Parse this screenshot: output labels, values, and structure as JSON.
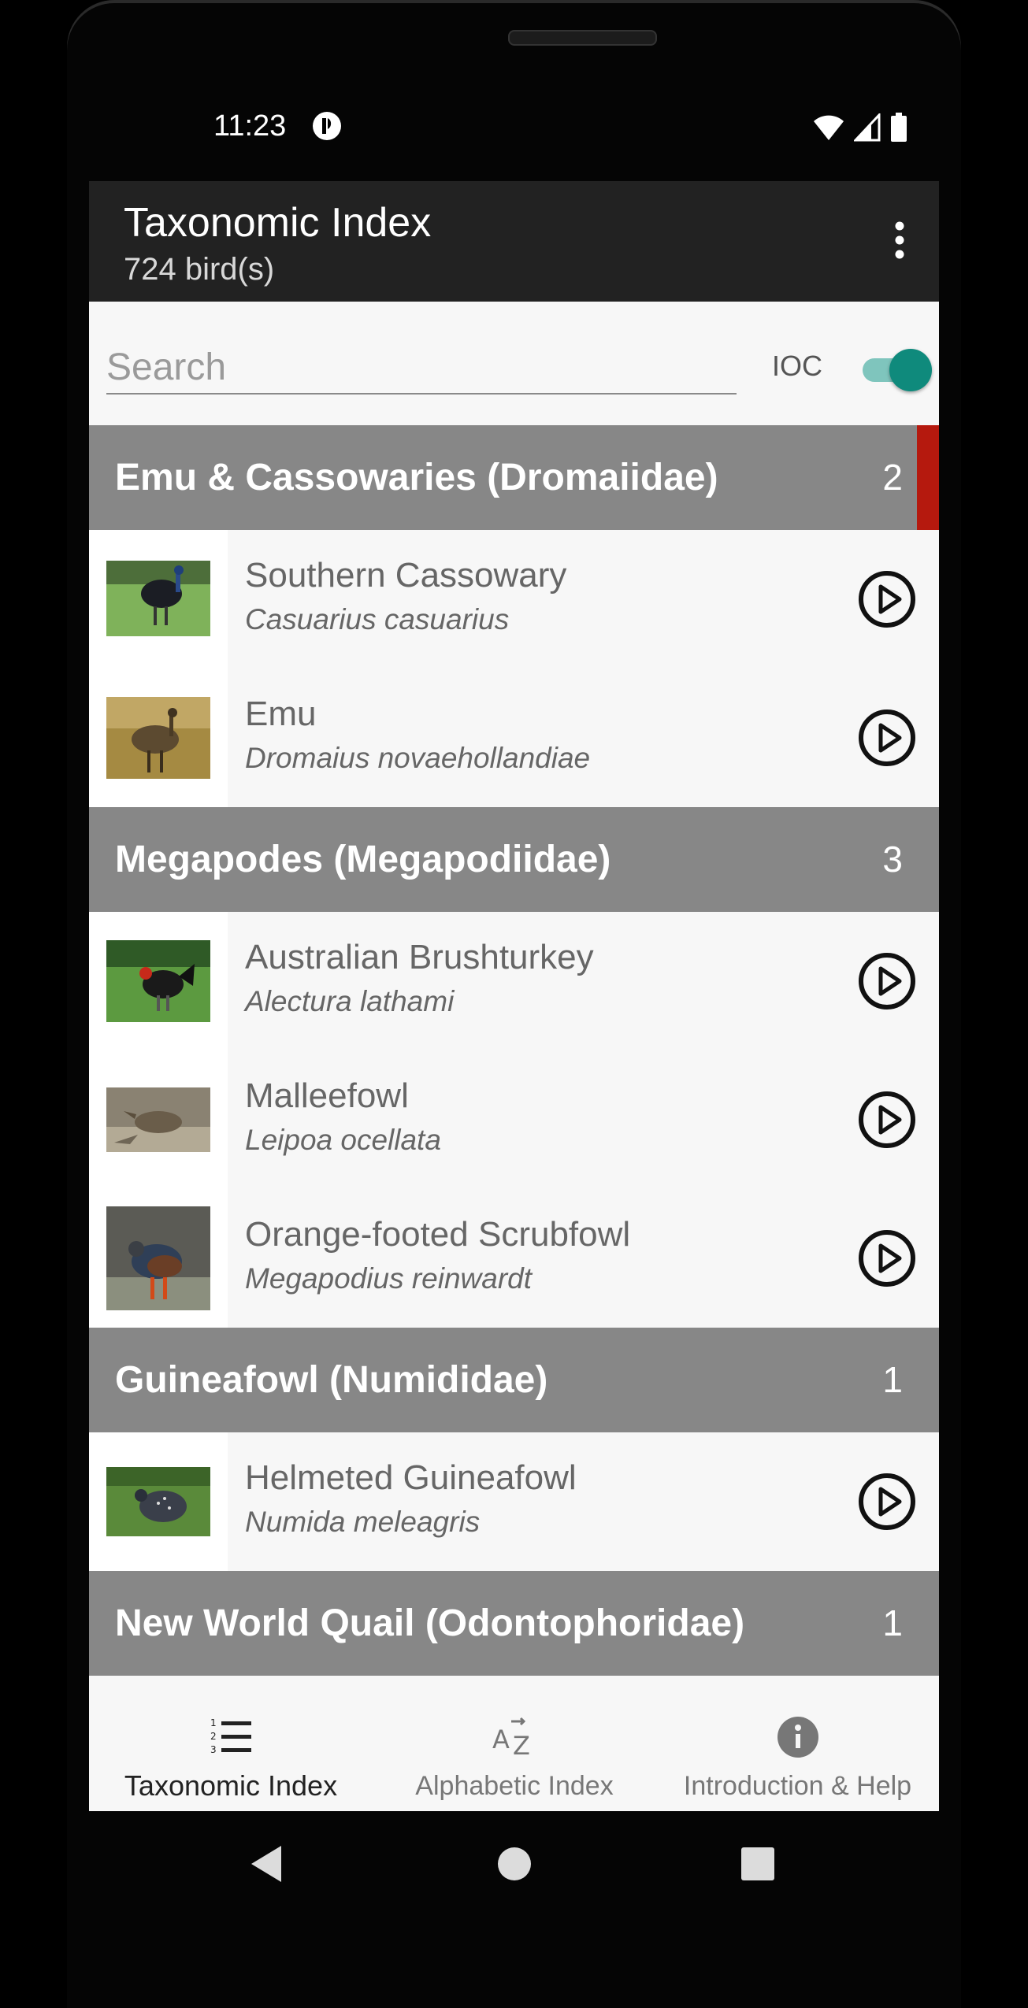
{
  "status_bar": {
    "time": "11:23"
  },
  "app_bar": {
    "title": "Taxonomic Index",
    "subtitle": "724 bird(s)"
  },
  "search": {
    "placeholder": "Search",
    "value": "",
    "ioc_label": "IOC",
    "ioc_enabled": true
  },
  "colors": {
    "accent": "#0f8a7c",
    "section_bg": "#878787",
    "section_marker": "#b5190e",
    "app_bar": "#222222"
  },
  "sections": [
    {
      "title": "Emu & Cassowaries (Dromaiidae)",
      "count": "2",
      "birds": [
        {
          "name": "Southern Cassowary",
          "latin": "Casuarius casuarius"
        },
        {
          "name": "Emu",
          "latin": "Dromaius novaehollandiae"
        }
      ]
    },
    {
      "title": "Megapodes (Megapodiidae)",
      "count": "3",
      "birds": [
        {
          "name": "Australian Brushturkey",
          "latin": "Alectura lathami"
        },
        {
          "name": "Malleefowl",
          "latin": "Leipoa ocellata"
        },
        {
          "name": "Orange-footed Scrubfowl",
          "latin": "Megapodius reinwardt"
        }
      ]
    },
    {
      "title": "Guineafowl (Numididae)",
      "count": "1",
      "birds": [
        {
          "name": "Helmeted Guineafowl",
          "latin": "Numida meleagris"
        }
      ]
    },
    {
      "title": "New World Quail (Odontophoridae)",
      "count": "1",
      "birds": []
    }
  ],
  "bottom_nav": [
    {
      "label": "Taxonomic Index",
      "icon": "numbered-list-icon",
      "active": true
    },
    {
      "label": "Alphabetic Index",
      "icon": "sort-az-icon",
      "active": false
    },
    {
      "label": "Introduction & Help",
      "icon": "info-icon",
      "active": false
    }
  ]
}
